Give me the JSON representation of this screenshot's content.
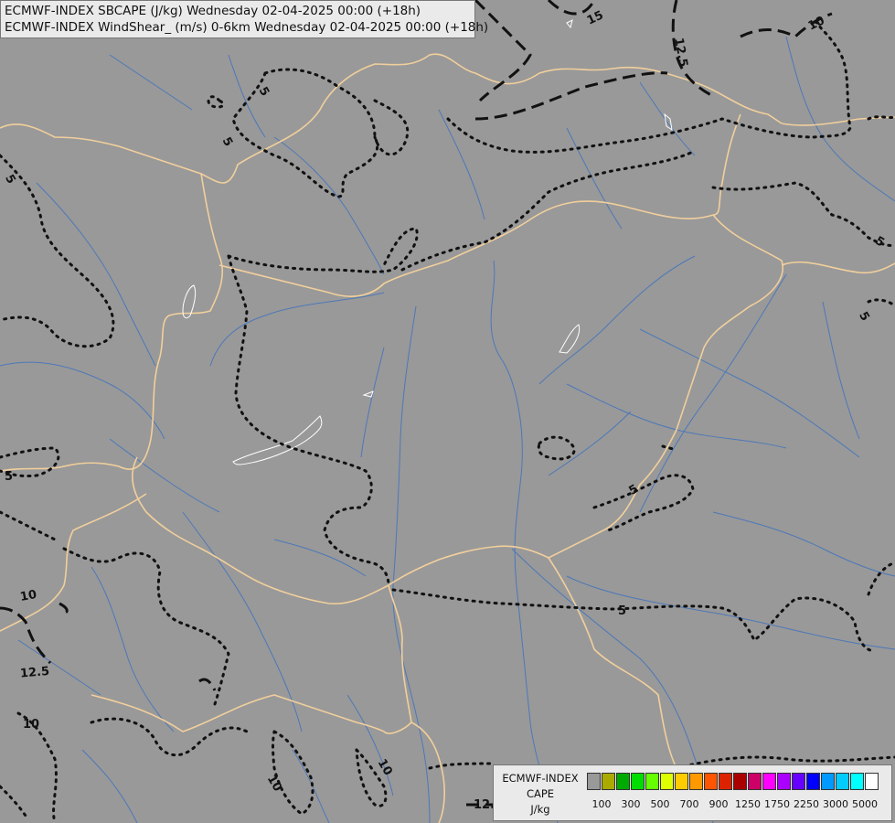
{
  "titles": {
    "line1": "ECMWF-INDEX SBCAPE (J/kg) Wednesday 02-04-2025 00:00 (+18h)",
    "line2": "ECMWF-INDEX WindShear_ (m/s) 0-6km Wednesday 02-04-2025 00:00 (+18h)"
  },
  "legend": {
    "source": "ECMWF-INDEX",
    "parameter": "CAPE",
    "unit": "J/kg",
    "colors": [
      "#999999",
      "#aaaa00",
      "#00aa00",
      "#00dd00",
      "#66ff00",
      "#ddff00",
      "#ffcc00",
      "#ff9900",
      "#ff5500",
      "#dd2200",
      "#aa0000",
      "#cc0066",
      "#ff00ff",
      "#aa00ff",
      "#6600ff",
      "#0000ff",
      "#0099ff",
      "#00ccff",
      "#00ffff",
      "#ffffff"
    ],
    "tick_labels": [
      "100",
      "300",
      "500",
      "700",
      "900",
      "1250",
      "1750",
      "2250",
      "3000",
      "5000"
    ]
  },
  "contour_labels": [
    "15",
    "10",
    "12.5",
    "5",
    "5",
    "5",
    "5",
    "5",
    "5",
    "5",
    "5",
    "10",
    "12.5",
    "10",
    "10",
    "10",
    "12.5"
  ]
}
